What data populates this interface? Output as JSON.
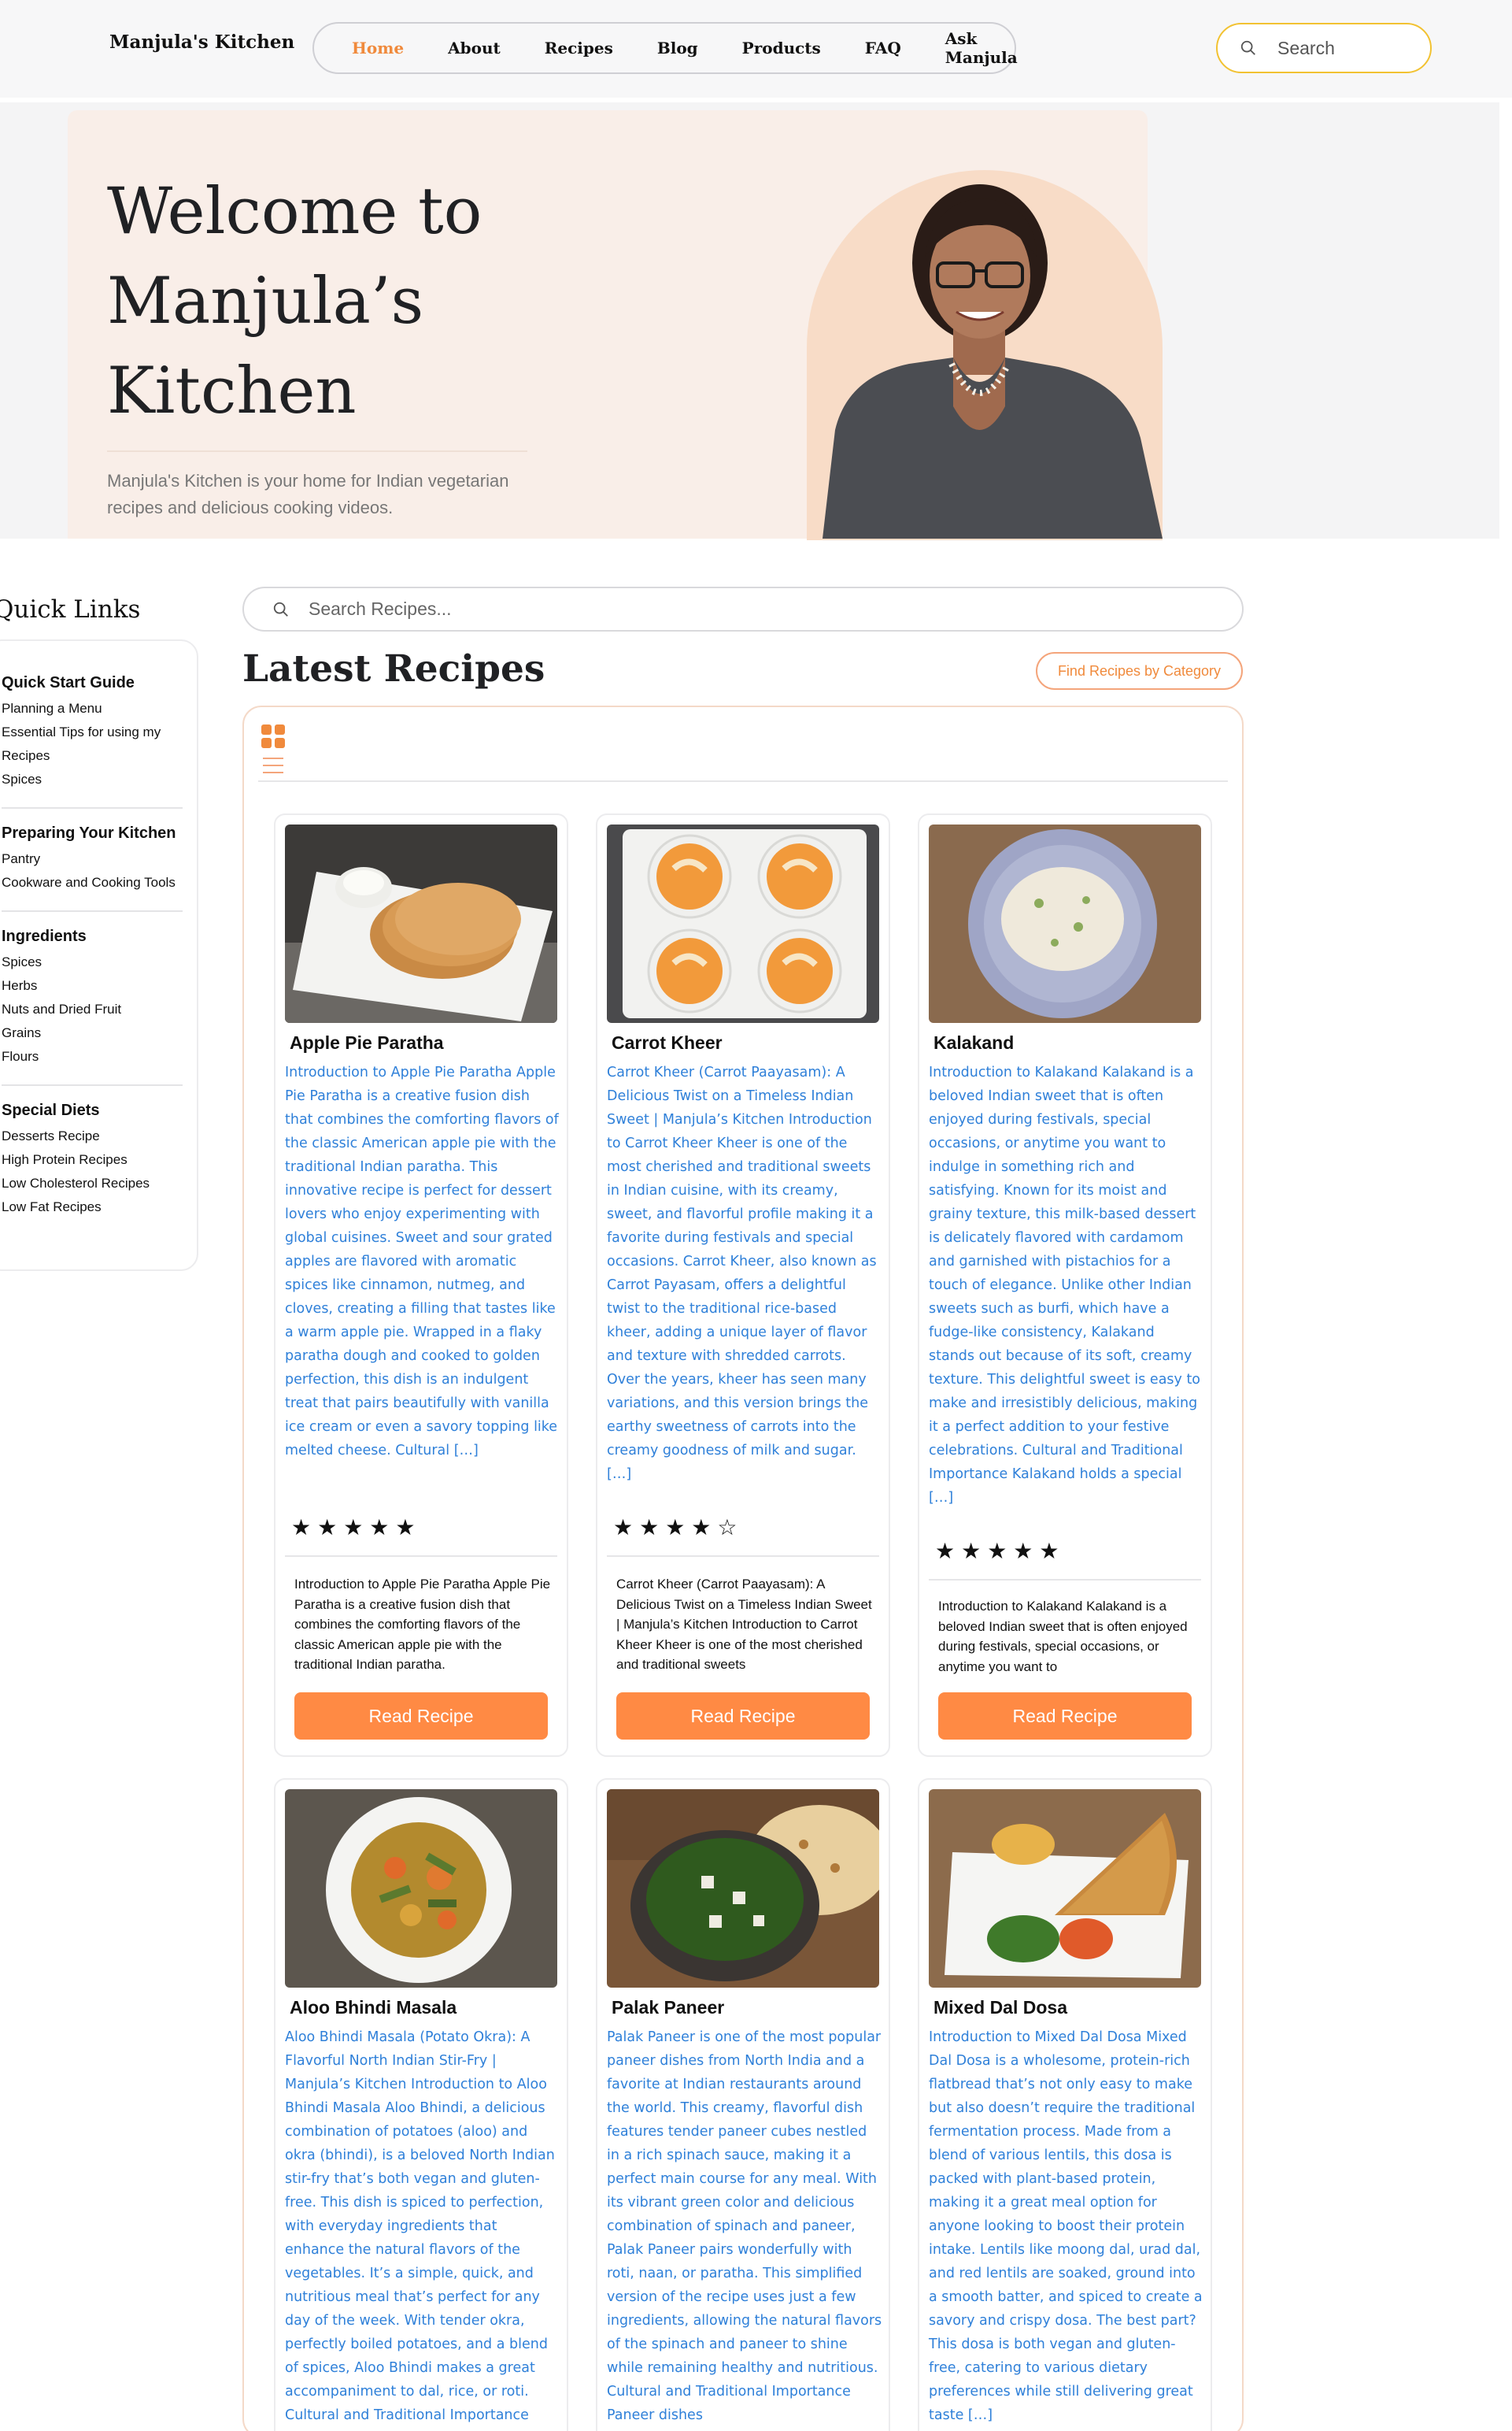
{
  "header": {
    "brand": "Manjula's Kitchen",
    "nav": [
      "Home",
      "About",
      "Recipes",
      "Blog",
      "Products",
      "FAQ",
      "Ask Manjula"
    ],
    "active_nav": "Home",
    "search_placeholder": "Search"
  },
  "hero": {
    "title": "Welcome to Manjula’s Kitchen",
    "subtitle": "Manjula's Kitchen is your home for Indian vegetarian recipes and delicious cooking videos."
  },
  "sidebar": {
    "title": "Quick Links",
    "groups": [
      {
        "heading": "Quick Start Guide",
        "links": [
          "Planning a Menu",
          "Essential Tips for using my Recipes",
          "Spices"
        ]
      },
      {
        "heading": "Preparing Your Kitchen",
        "links": [
          "Pantry",
          "Cookware and Cooking Tools"
        ]
      },
      {
        "heading": "Ingredients",
        "links": [
          "Spices",
          "Herbs",
          "Nuts and Dried Fruit",
          "Grains",
          "Flours"
        ]
      },
      {
        "heading": "Special Diets",
        "links": [
          "Desserts Recipe",
          "High Protein Recipes",
          "Low Cholesterol Recipes",
          "Low Fat Recipes"
        ]
      }
    ]
  },
  "main": {
    "search_placeholder": "Search Recipes...",
    "heading": "Latest Recipes",
    "category_button": "Find Recipes by Category",
    "read_label": "Read Recipe"
  },
  "recipes": [
    {
      "title": "Apple Pie Paratha",
      "description": "Introduction to Apple Pie Paratha Apple Pie Paratha is a creative fusion dish that combines the comforting flavors of the classic American apple pie with the traditional Indian paratha. This innovative recipe is perfect for dessert lovers who enjoy experimenting with global cuisines. Sweet and sour grated apples are flavored with aromatic spices like cinnamon, nutmeg, and cloves, creating a filling that tastes like a warm apple pie. Wrapped in a flaky paratha dough and cooked to golden perfection, this dish is an indulgent treat that pairs beautifully with vanilla ice cream or even a savory topping like melted cheese. Cultural […]",
      "stars": "★★★★★",
      "rating": 5,
      "excerpt": "Introduction to Apple Pie Paratha Apple Pie Paratha is a creative fusion dish that combines the comforting flavors of the classic American apple pie with the traditional Indian paratha."
    },
    {
      "title": "Carrot Kheer",
      "description": "Carrot Kheer (Carrot Paayasam): A Delicious Twist on a Timeless Indian Sweet | Manjula’s Kitchen Introduction to Carrot Kheer Kheer is one of the most cherished and traditional sweets in Indian cuisine, with its creamy, sweet, and flavorful profile making it a favorite during festivals and special occasions. Carrot Kheer, also known as Carrot Payasam, offers a delightful twist to the traditional rice-based kheer, adding a unique layer of flavor and texture with shredded carrots. Over the years, kheer has seen many variations, and this version brings the earthy sweetness of carrots into the creamy goodness of milk and sugar. […]",
      "stars": "★★★★☆",
      "rating": 4.5,
      "excerpt": "Carrot Kheer (Carrot Paayasam): A Delicious Twist on a Timeless Indian Sweet | Manjula’s Kitchen Introduction to Carrot Kheer Kheer is one of the most cherished and traditional sweets"
    },
    {
      "title": "Kalakand",
      "description": "Introduction to Kalakand Kalakand is a beloved Indian sweet that is often enjoyed during festivals, special occasions, or anytime you want to indulge in something rich and satisfying. Known for its moist and grainy texture, this milk-based dessert is delicately flavored with cardamom and garnished with pistachios for a touch of elegance. Unlike other Indian sweets such as burfi, which have a fudge-like consistency, Kalakand stands out because of its soft, creamy texture. This delightful sweet is easy to make and irresistibly delicious, making it a perfect addition to your festive celebrations. Cultural and Traditional Importance Kalakand holds a special […]",
      "stars": "★★★★★",
      "rating": 5,
      "excerpt": "Introduction to Kalakand Kalakand is a beloved Indian sweet that is often enjoyed during festivals, special occasions, or anytime you want to"
    },
    {
      "title": "Aloo Bhindi Masala",
      "description": "Aloo Bhindi Masala (Potato Okra): A Flavorful North Indian Stir-Fry | Manjula’s Kitchen Introduction to Aloo Bhindi Masala Aloo Bhindi, a delicious combination of potatoes (aloo) and okra (bhindi), is a beloved North Indian stir-fry that’s both vegan and gluten-free. This dish is spiced to perfection, with everyday ingredients that enhance the natural flavors of the vegetables. It’s a simple, quick, and nutritious meal that’s perfect for any day of the week. With tender okra, perfectly boiled potatoes, and a blend of spices, Aloo Bhindi makes a great accompaniment to dal, rice, or roti. Cultural and Traditional Importance"
    },
    {
      "title": "Palak Paneer",
      "description": "Palak Paneer is one of the most popular paneer dishes from North India and a favorite at Indian restaurants around the world. This creamy, flavorful dish features tender paneer cubes nestled in a rich spinach sauce, making it a perfect main course for any meal.  With its vibrant green color and delicious combination of spinach and paneer, Palak Paneer pairs wonderfully with roti, naan, or paratha. This simplified version of the recipe uses just a few ingredients, allowing the natural flavors of the spinach and paneer to shine while remaining healthy and nutritious. Cultural and Traditional Importance  Paneer dishes"
    },
    {
      "title": "Mixed Dal Dosa",
      "description": "Introduction to Mixed Dal Dosa Mixed Dal Dosa is a wholesome, protein-rich flatbread that’s not only easy to make but also doesn’t require the traditional fermentation process. Made from a blend of various lentils, this dosa is packed with plant-based protein, making it a great meal option for anyone looking to boost their protein intake. Lentils like moong dal, urad dal, and red lentils are soaked, ground into a smooth batter, and spiced to create a savory and crispy dosa. The best part? This dosa is both vegan and gluten-free, catering to various dietary preferences while still delivering great taste […]"
    }
  ],
  "colors": {
    "accent": "#ff8a44",
    "link_blue": "#2f80d9",
    "hero_bg": "#f9eee8",
    "search_border": "#f2c232"
  },
  "icons": [
    "search-icon",
    "grid-view-icon",
    "list-view-icon",
    "star-icon"
  ]
}
